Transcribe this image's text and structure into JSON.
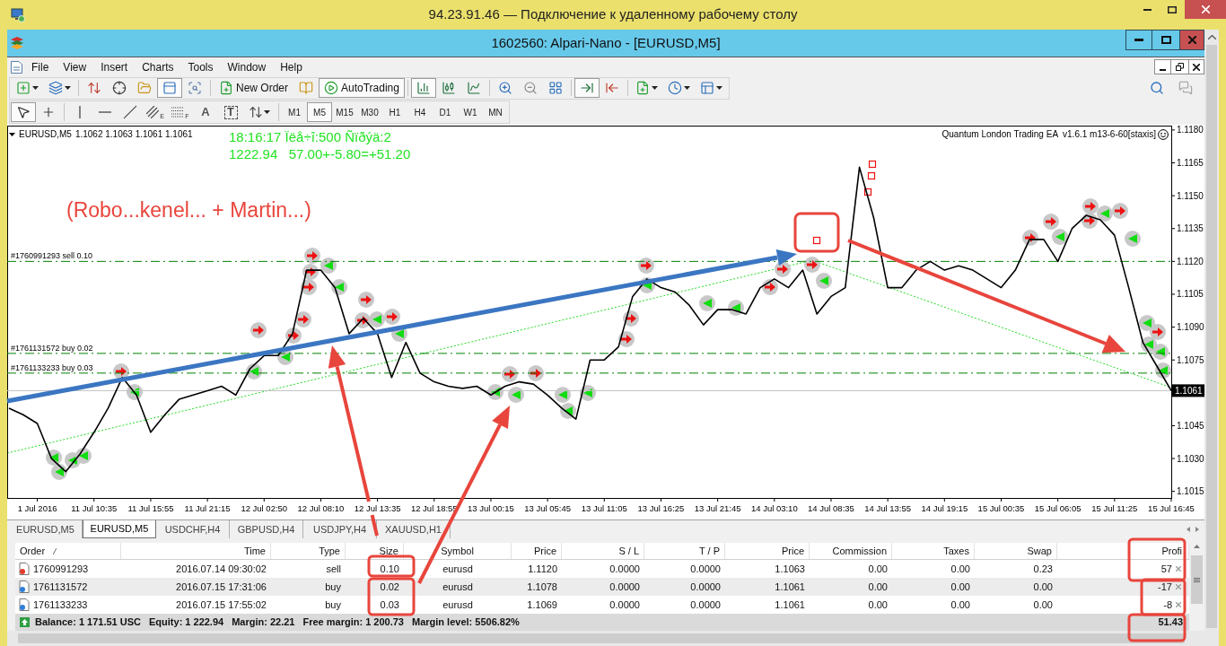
{
  "remote_window": {
    "title": "94.23.91.46 — Подключение к удаленному рабочему столу"
  },
  "terminal_window": {
    "title": "1602560: Alpari-Nano - [EURUSD,M5]"
  },
  "menu": [
    "File",
    "View",
    "Insert",
    "Charts",
    "Tools",
    "Window",
    "Help"
  ],
  "toolbar": [
    {
      "kind": "icon",
      "pressed": false,
      "dropdown": true
    },
    {
      "kind": "icon",
      "pressed": false,
      "dropdown": true
    },
    {
      "kind": "separator"
    },
    {
      "kind": "icon",
      "pressed": false
    },
    {
      "kind": "icon",
      "pressed": false
    },
    {
      "kind": "icon",
      "pressed": false
    },
    {
      "kind": "icon",
      "pressed": true
    },
    {
      "kind": "icon",
      "pressed": false
    },
    {
      "kind": "separator"
    },
    {
      "kind": "text",
      "label": "New Order",
      "pressed": false
    },
    {
      "kind": "icon",
      "pressed": false
    },
    {
      "kind": "text",
      "label": "AutoTrading",
      "pressed": true
    },
    {
      "kind": "separator"
    },
    {
      "kind": "icon",
      "pressed": true
    },
    {
      "kind": "icon",
      "pressed": false
    },
    {
      "kind": "icon",
      "pressed": false
    },
    {
      "kind": "separator"
    },
    {
      "kind": "icon",
      "pressed": false
    },
    {
      "kind": "icon",
      "pressed": false
    },
    {
      "kind": "icon",
      "pressed": false
    },
    {
      "kind": "separator"
    },
    {
      "kind": "icon",
      "pressed": true
    },
    {
      "kind": "icon",
      "pressed": false
    },
    {
      "kind": "separator"
    },
    {
      "kind": "icon",
      "pressed": false,
      "dropdown": true
    },
    {
      "kind": "icon",
      "pressed": false,
      "dropdown": true
    },
    {
      "kind": "icon",
      "pressed": false,
      "dropdown": true
    }
  ],
  "drawing_toolbar": [
    {
      "kind": "icon",
      "pressed": true
    },
    {
      "kind": "icon",
      "pressed": false
    },
    {
      "kind": "separator"
    },
    {
      "kind": "icon",
      "pressed": false
    },
    {
      "kind": "icon",
      "pressed": false
    },
    {
      "kind": "icon",
      "pressed": false
    },
    {
      "kind": "icon",
      "pressed": false,
      "letter": "E"
    },
    {
      "kind": "icon",
      "pressed": false,
      "letter": "F"
    },
    {
      "kind": "glyph",
      "glyph": "A",
      "pressed": false
    },
    {
      "kind": "framed_glyph",
      "glyph": "T",
      "pressed": false
    },
    {
      "kind": "icon",
      "pressed": false,
      "dropdown": true
    }
  ],
  "timeframes": [
    {
      "label": "M1",
      "selected": false
    },
    {
      "label": "M5",
      "selected": true
    },
    {
      "label": "M15",
      "selected": false
    },
    {
      "label": "M30",
      "selected": false
    },
    {
      "label": "H1",
      "selected": false
    },
    {
      "label": "H4",
      "selected": false
    },
    {
      "label": "D1",
      "selected": false
    },
    {
      "label": "W1",
      "selected": false
    },
    {
      "label": "MN",
      "selected": false
    }
  ],
  "chart": {
    "symbol": "EURUSD,M5",
    "quotes": "1.1062 1.1063 1.1061 1.1061",
    "info_lines": [
      "18:16:17 Ïëå÷î:500 Ñïðýä:2",
      "1222.94   57.00+-5.80=+51.20"
    ],
    "expert": "Quantum London Trading EA  v1.6.1 m13-6-60[staxis]",
    "note": "(Robo...kenel... + Martin...)",
    "chart_data": {
      "type": "line",
      "color": "#000000",
      "categories": [
        null,
        null,
        "1 Jul 2016",
        null,
        null,
        null,
        "11 Jul 10:35",
        null,
        null,
        null,
        "11 Jul 15:55",
        null,
        null,
        null,
        "11 Jul 21:15",
        null,
        null,
        null,
        "12 Jul 02:50",
        null,
        null,
        null,
        "12 Jul 08:10",
        null,
        null,
        null,
        "12 Jul 13:35",
        null,
        null,
        null,
        "12 Jul 18:55",
        null,
        null,
        null,
        "13 Jul 00:15",
        null,
        null,
        null,
        "13 Jul 05:45",
        null,
        null,
        null,
        "13 Jul 11:05",
        null,
        null,
        null,
        "13 Jul 16:25",
        null,
        null,
        null,
        "13 Jul 21:45",
        null,
        null,
        null,
        "14 Jul 03:10",
        null,
        null,
        null,
        "14 Jul 08:35",
        null,
        null,
        null,
        "14 Jul 13:55",
        null,
        null,
        null,
        "14 Jul 19:15",
        null,
        null,
        null,
        "15 Jul 00:35",
        null,
        null,
        null,
        "15 Jul 06:05",
        null,
        null,
        null,
        "15 Jul 11:25",
        null,
        null,
        null,
        "15 Jul 16:45"
      ],
      "values": [
        1.1053,
        1.105,
        1.1046,
        1.103,
        1.1024,
        1.1032,
        1.1042,
        1.1053,
        1.1067,
        1.1059,
        1.1042,
        1.105,
        1.1057,
        1.1059,
        1.1061,
        1.1063,
        1.1059,
        1.1071,
        1.1077,
        1.1077,
        1.1087,
        1.1116,
        1.1116,
        1.1108,
        1.1087,
        1.1094,
        1.1087,
        1.1067,
        1.1083,
        1.1069,
        1.1065,
        1.1063,
        1.1062,
        1.1063,
        1.1059,
        1.1063,
        1.1065,
        1.1064,
        1.1059,
        1.1053,
        1.1048,
        1.1075,
        1.1075,
        1.1081,
        1.1104,
        1.1112,
        1.1108,
        1.1106,
        1.11,
        1.1091,
        1.1098,
        1.1098,
        1.1096,
        1.1108,
        1.1112,
        1.1108,
        1.1116,
        1.1096,
        1.1104,
        1.1108,
        1.1163,
        1.114,
        1.1108,
        1.1108,
        1.1116,
        1.112,
        1.1116,
        1.1118,
        1.1116,
        1.1112,
        1.1108,
        1.1116,
        1.113,
        1.113,
        1.112,
        1.1135,
        1.1141,
        1.1139,
        1.1132,
        1.1108,
        1.1083,
        1.1072,
        1.1061
      ],
      "ylim": [
        1.1012,
        1.1182
      ],
      "yticks": [
        1.1015,
        {
          "value": 1.103,
          "label": "1.1030"
        },
        1.1045,
        1.1075,
        {
          "value": 1.109,
          "label": "1.1090"
        },
        1.1105,
        {
          "value": 1.112,
          "label": "1.1120"
        },
        1.1135,
        {
          "value": 1.115,
          "label": "1.1150"
        },
        1.1165,
        {
          "value": 1.118,
          "label": "1.1180"
        }
      ],
      "ref_lines": [
        {
          "axis": "y",
          "value": 1.112,
          "label": "#1760991293 sell 0.10",
          "color": "#008000",
          "line_style": "dashdot"
        },
        {
          "axis": "y",
          "value": 1.1078,
          "label": "#1761131572 buy 0.02",
          "color": "#008000",
          "line_style": "dashdot"
        },
        {
          "axis": "y",
          "value": 1.1069,
          "label": "#1761133233 buy 0.03",
          "color": "#008000",
          "line_style": "dashdot"
        },
        {
          "axis": "y",
          "value": 1.1061,
          "label": "1.1061",
          "color": "#c0c0c0",
          "line_style": "solid"
        }
      ]
    }
  },
  "chart_tabs": [
    {
      "label": "EURUSD,M5",
      "selected": false
    },
    {
      "label": "EURUSD,M5",
      "selected": true
    },
    {
      "label": "USDCHF,H4",
      "selected": false
    },
    {
      "label": "GBPUSD,H4",
      "selected": false
    },
    {
      "label": "USDJPY,H4",
      "selected": false
    },
    {
      "label": "XAUUSD,H1",
      "selected": false
    }
  ],
  "trade_table": {
    "columns": [
      "Order",
      "Time",
      "Type",
      "Size",
      "Symbol",
      "Price",
      "S / L",
      "T / P",
      "Price",
      "Commission",
      "Taxes",
      "Swap",
      "Profi"
    ],
    "rows": [
      {
        "kind": "sell",
        "cells": [
          "1760991293",
          "2016.07.14 09:30:02",
          "sell",
          "0.10",
          "eurusd",
          "1.1120",
          "0.0000",
          "0.0000",
          "1.1063",
          "0.00",
          "0.00",
          "0.23",
          "57"
        ]
      },
      {
        "kind": "buy",
        "cells": [
          "1761131572",
          "2016.07.15 17:31:06",
          "buy",
          "0.02",
          "eurusd",
          "1.1078",
          "0.0000",
          "0.0000",
          "1.1061",
          "0.00",
          "0.00",
          "0.00",
          "-17"
        ]
      },
      {
        "kind": "buy",
        "cells": [
          "1761133233",
          "2016.07.15 17:55:02",
          "buy",
          "0.03",
          "eurusd",
          "1.1069",
          "0.0000",
          "0.0000",
          "1.1061",
          "0.00",
          "0.00",
          "0.00",
          "-8"
        ]
      }
    ],
    "summary": [
      "Balance: 1 171.51 USC",
      "Equity: 1 222.94",
      "Margin: 22.21",
      "Free margin: 1 200.73",
      "Margin level: 5506.82%"
    ],
    "summary_profit": "51.43"
  }
}
